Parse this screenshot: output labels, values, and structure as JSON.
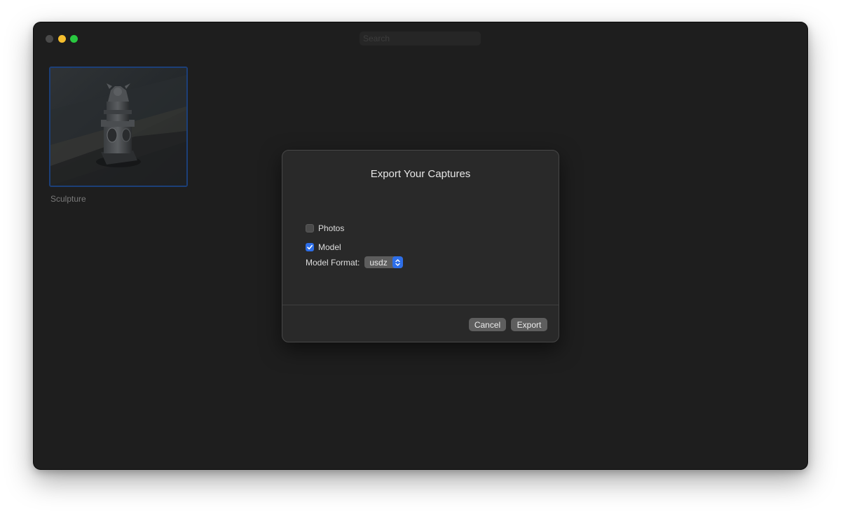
{
  "window": {
    "search_placeholder": "Search"
  },
  "gallery": {
    "items": [
      {
        "label": "Sculpture"
      }
    ]
  },
  "dialog": {
    "title": "Export Your Captures",
    "options": {
      "photos": {
        "label": "Photos",
        "checked": false
      },
      "model": {
        "label": "Model",
        "checked": true
      }
    },
    "model_format": {
      "label": "Model Format:",
      "value": "usdz"
    },
    "buttons": {
      "cancel": "Cancel",
      "export": "Export"
    }
  },
  "colors": {
    "accent": "#2d6ee8",
    "window_bg": "#1e1e1e",
    "dialog_bg": "#292929",
    "selection_border": "#1c3f78"
  }
}
